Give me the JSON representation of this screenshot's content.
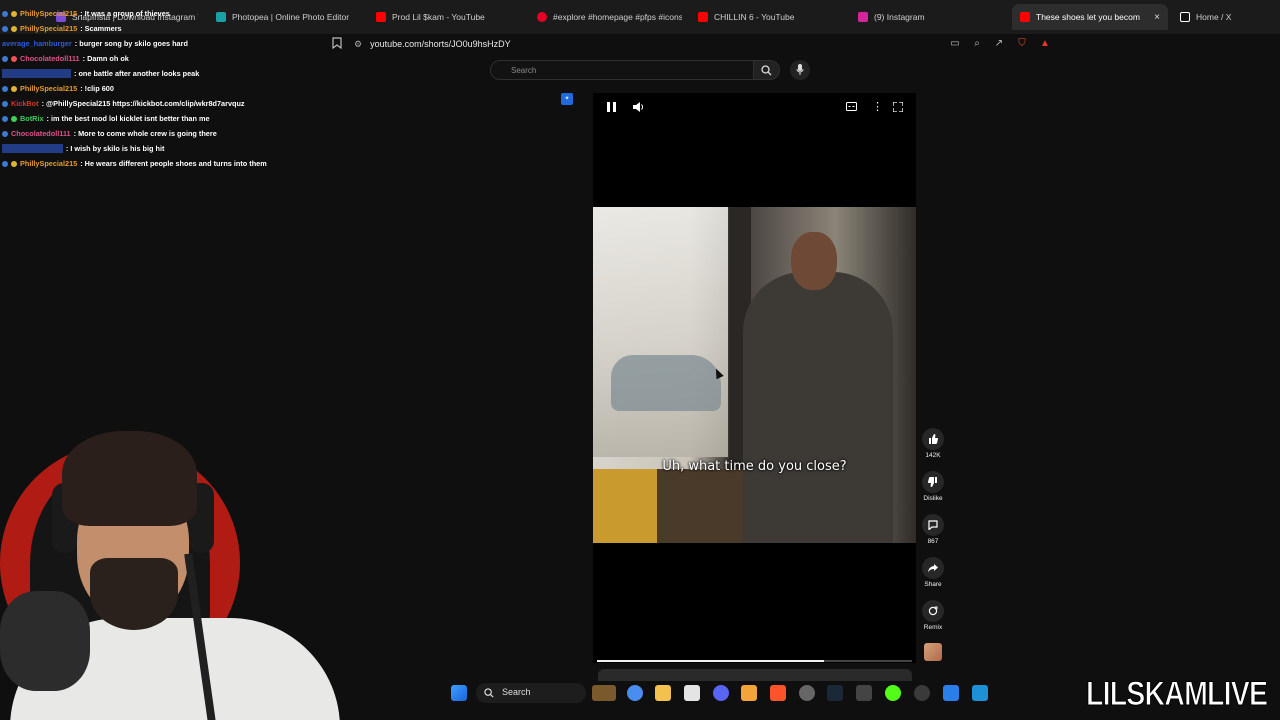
{
  "browser": {
    "tabs": [
      {
        "label": "SnapInsta | Download Instagram Vid",
        "icon": "snapinsta-icon",
        "color": "#7b4dd6"
      },
      {
        "label": "Photopea | Online Photo Editor",
        "icon": "photopea-icon",
        "color": "#19a0a5"
      },
      {
        "label": "Prod Lil $kam - YouTube",
        "icon": "youtube-icon",
        "color": "#ff0000"
      },
      {
        "label": "#explore #homepage #pfps #icons",
        "icon": "pinterest-icon",
        "color": "#e60023"
      },
      {
        "label": "CHILLIN 6 - YouTube",
        "icon": "youtube-icon",
        "color": "#ff0000"
      },
      {
        "label": "(9) Instagram",
        "icon": "instagram-icon",
        "color": "#d6249f"
      },
      {
        "label": "These shoes let you become",
        "icon": "youtube-icon",
        "color": "#ff0000",
        "active": true,
        "close": "×"
      },
      {
        "label": "Home / X",
        "icon": "x-icon",
        "color": "#ffffff"
      }
    ],
    "url": "youtube.com/shorts/JO0u9hsHzDY"
  },
  "youtube": {
    "search_placeholder": "Search",
    "subtitle": "Uh, what time do you close?",
    "progress_fraction": 0.72,
    "actions": [
      {
        "name": "like",
        "icon": "thumbs-up-icon",
        "glyph": "👍",
        "label": "142K"
      },
      {
        "name": "dislike",
        "icon": "thumbs-down-icon",
        "glyph": "👎",
        "label": "Dislike"
      },
      {
        "name": "comments",
        "icon": "comment-icon",
        "glyph": "💬",
        "label": "867"
      },
      {
        "name": "share",
        "icon": "share-icon",
        "glyph": "↪",
        "label": "Share"
      },
      {
        "name": "remix",
        "icon": "remix-icon",
        "glyph": "⟳",
        "label": "Remix"
      }
    ]
  },
  "chat": [
    {
      "user": "PhillySpecial215",
      "color": "#e89b2b",
      "msg": "It was a group of thieves"
    },
    {
      "user": "PhillySpecial215",
      "color": "#e89b2b",
      "msg": "Scammers"
    },
    {
      "user": "average_hamburger",
      "color": "#2f5bd6",
      "msg": "burger song by skilo goes hard"
    },
    {
      "user": "Chocolatedoll111",
      "color": "#e0508a",
      "msg": "Damn oh ok"
    },
    {
      "user": "xxxxxxxxxxxxxxxxx",
      "color": "#2f5bd6",
      "msg": "one battle after another looks peak"
    },
    {
      "user": "PhillySpecial215",
      "color": "#e89b2b",
      "msg": "!clip 600"
    },
    {
      "user": "KickBot",
      "color": "#d9342b",
      "msg": "@PhillySpecial215 https://kickbot.com/clip/wkr8d7arvquz"
    },
    {
      "user": "BotRix",
      "color": "#3fcf5a",
      "msg": "im the best mod lol kicklet isnt better than me"
    },
    {
      "user": "Chocolatedoll111",
      "color": "#e0508a",
      "msg": "More to come whole crew is going there"
    },
    {
      "user": "xxxxxxxxxxxxxxx",
      "color": "#2f5bd6",
      "msg": "I wish by skilo is his big hit"
    },
    {
      "user": "PhillySpecial215",
      "color": "#e89b2b",
      "msg": "He wears different people shoes and turns into them"
    }
  ],
  "taskbar": {
    "search_label": "Search"
  },
  "watermark": "LILSKAMLIVE"
}
